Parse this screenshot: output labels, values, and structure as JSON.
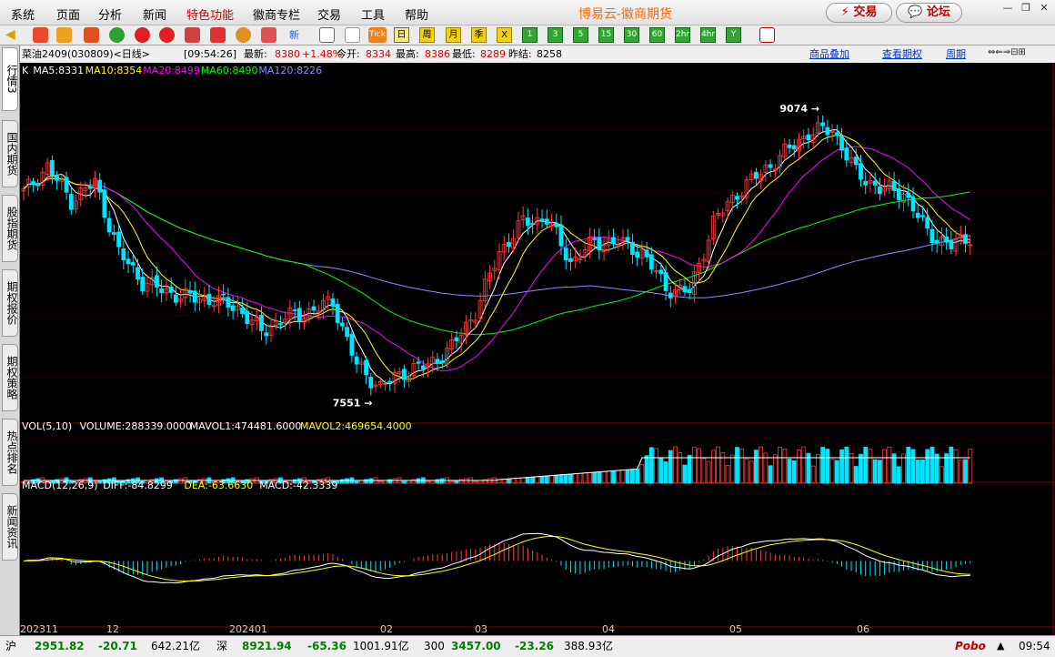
{
  "menu": [
    "系统",
    "页面",
    "分析",
    "新闻",
    "特色功能",
    "徽商专栏",
    "交易",
    "工具",
    "帮助"
  ],
  "app_title": "博易云-徽商期货",
  "buttons": {
    "trade": "交易",
    "forum": "论坛"
  },
  "toolbar": {
    "icons": [
      "back-icon",
      "home-icon",
      "layers-icon",
      "quote-icon",
      "refresh-icon",
      "zoom-in-icon",
      "zoom-out-icon",
      "window-icon",
      "pen-icon",
      "bell-icon",
      "filter-icon",
      "news-icon",
      "list-icon",
      "trend-icon",
      "tick-icon"
    ],
    "tick_label": "Tick",
    "new_label": "新",
    "periods": [
      "日",
      "周",
      "月",
      "季",
      "X",
      "1",
      "3",
      "5",
      "15",
      "30",
      "60",
      "2hr",
      "4hr",
      "Y"
    ],
    "selected_period": "日"
  },
  "sidebar": {
    "tabs": [
      "行情3",
      "国内期货",
      "股指期货",
      "期权报价",
      "期权策略",
      "热点排名",
      "新闻资讯"
    ]
  },
  "info": {
    "instrument": "菜油2409(030809)<日线>",
    "time": "[09:54:26]",
    "last_label": "最新:",
    "last": "8380",
    "chg": "+1.48%",
    "open_label": "今开:",
    "open": "8334",
    "high_label": "最高:",
    "high": "8386",
    "low_label": "最低:",
    "low": "8289",
    "prev_label": "昨结:",
    "prev": "8258",
    "links": [
      "商品叠加",
      "查看期权",
      "周期"
    ]
  },
  "colors": {
    "up": "#ff3d3d",
    "down": "#00e5ff",
    "ma5": "#ffffff",
    "ma10": "#ffff00",
    "ma20": "#ff00ff",
    "ma60": "#00ff00",
    "ma120": "#8c8cff",
    "dif": "#ffffff",
    "dea": "#ffff00"
  },
  "chart_data": {
    "type": "candlestick",
    "main_legend": [
      {
        "text": "K",
        "color": "#ffffff"
      },
      {
        "text": "MA5:8331",
        "color": "#ffffff"
      },
      {
        "text": "MA10:8354",
        "color": "#ffff00"
      },
      {
        "text": "MA20:8499",
        "color": "#ff00ff"
      },
      {
        "text": "MA60:8490",
        "color": "#00ff00"
      },
      {
        "text": "MA120:8226",
        "color": "#8c8cff"
      }
    ],
    "high_mark": "9074",
    "low_mark": "7551",
    "ylim": [
      7430,
      9180
    ],
    "volume_legend": [
      {
        "text": "VOL(5,10)",
        "color": "#ffffff"
      },
      {
        "text": "VOLUME:288339.0000",
        "color": "#ffffff"
      },
      {
        "text": "MAVOL1:474481.6000",
        "color": "#ffffff"
      },
      {
        "text": "MAVOL2:469654.4000",
        "color": "#ffff00"
      }
    ],
    "macd_legend": [
      {
        "text": "MACD(12,26,9)",
        "color": "#ffffff"
      },
      {
        "text": "DIFF:-84.8299",
        "color": "#ffffff"
      },
      {
        "text": "DEA:-63.6630",
        "color": "#ffff00"
      },
      {
        "text": "MACD:-42.3339",
        "color": "#ffffff"
      }
    ],
    "x_labels": [
      "202311",
      "12",
      "202401",
      "02",
      "03",
      "04",
      "05",
      "06"
    ],
    "anchors": [
      [
        0,
        8600
      ],
      [
        5,
        8730
      ],
      [
        10,
        8560
      ],
      [
        15,
        8650
      ],
      [
        20,
        8300
      ],
      [
        25,
        8150
      ],
      [
        30,
        8100
      ],
      [
        35,
        8070
      ],
      [
        40,
        8060
      ],
      [
        45,
        8020
      ],
      [
        50,
        7900
      ],
      [
        55,
        7970
      ],
      [
        60,
        8000
      ],
      [
        65,
        8050
      ],
      [
        70,
        7730
      ],
      [
        75,
        7620
      ],
      [
        80,
        7700
      ],
      [
        85,
        7730
      ],
      [
        90,
        7820
      ],
      [
        95,
        8000
      ],
      [
        100,
        8300
      ],
      [
        105,
        8450
      ],
      [
        110,
        8470
      ],
      [
        115,
        8250
      ],
      [
        120,
        8350
      ],
      [
        125,
        8350
      ],
      [
        130,
        8300
      ],
      [
        135,
        8120
      ],
      [
        140,
        8100
      ],
      [
        145,
        8450
      ],
      [
        150,
        8600
      ],
      [
        155,
        8700
      ],
      [
        160,
        8800
      ],
      [
        165,
        8900
      ],
      [
        170,
        8920
      ],
      [
        175,
        8700
      ],
      [
        180,
        8620
      ],
      [
        185,
        8600
      ],
      [
        190,
        8400
      ],
      [
        195,
        8330
      ],
      [
        199,
        8380
      ]
    ]
  },
  "footer": {
    "sh_label": "沪",
    "sh_val": "2951.82",
    "sh_chg": "-20.71",
    "sh_amt": "642.21亿",
    "sz_label": "深",
    "sz_val": "8921.94",
    "sz_chg": "-65.36",
    "sz_amt": "1001.91亿",
    "c3_label": "300",
    "c3_val": "3457.00",
    "c3_chg": "-23.26",
    "c3_amt": "388.93亿",
    "brand": "Pobo",
    "clock": "09:54"
  }
}
